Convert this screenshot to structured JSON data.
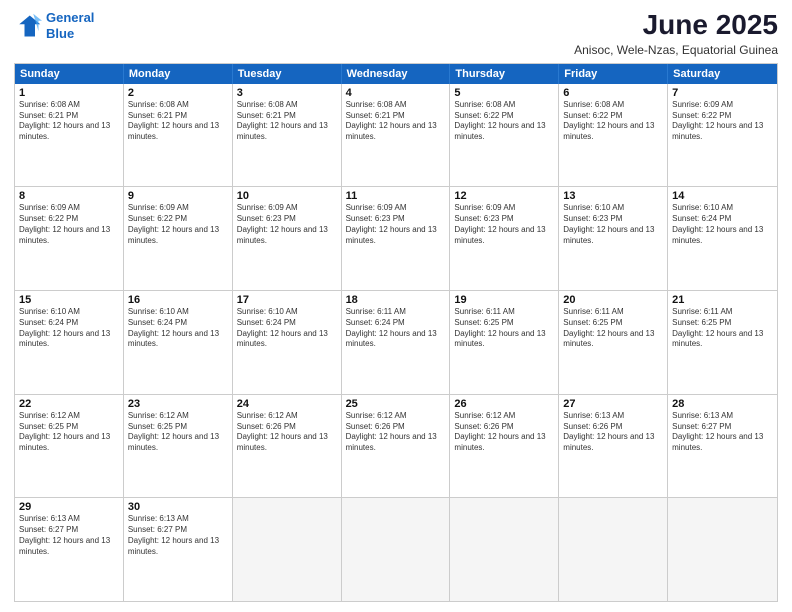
{
  "logo": {
    "line1": "General",
    "line2": "Blue"
  },
  "title": "June 2025",
  "subtitle": "Anisoc, Wele-Nzas, Equatorial Guinea",
  "header_days": [
    "Sunday",
    "Monday",
    "Tuesday",
    "Wednesday",
    "Thursday",
    "Friday",
    "Saturday"
  ],
  "weeks": [
    [
      {
        "day": "1",
        "sunrise": "Sunrise: 6:08 AM",
        "sunset": "Sunset: 6:21 PM",
        "daylight": "Daylight: 12 hours and 13 minutes."
      },
      {
        "day": "2",
        "sunrise": "Sunrise: 6:08 AM",
        "sunset": "Sunset: 6:21 PM",
        "daylight": "Daylight: 12 hours and 13 minutes."
      },
      {
        "day": "3",
        "sunrise": "Sunrise: 6:08 AM",
        "sunset": "Sunset: 6:21 PM",
        "daylight": "Daylight: 12 hours and 13 minutes."
      },
      {
        "day": "4",
        "sunrise": "Sunrise: 6:08 AM",
        "sunset": "Sunset: 6:21 PM",
        "daylight": "Daylight: 12 hours and 13 minutes."
      },
      {
        "day": "5",
        "sunrise": "Sunrise: 6:08 AM",
        "sunset": "Sunset: 6:22 PM",
        "daylight": "Daylight: 12 hours and 13 minutes."
      },
      {
        "day": "6",
        "sunrise": "Sunrise: 6:08 AM",
        "sunset": "Sunset: 6:22 PM",
        "daylight": "Daylight: 12 hours and 13 minutes."
      },
      {
        "day": "7",
        "sunrise": "Sunrise: 6:09 AM",
        "sunset": "Sunset: 6:22 PM",
        "daylight": "Daylight: 12 hours and 13 minutes."
      }
    ],
    [
      {
        "day": "8",
        "sunrise": "Sunrise: 6:09 AM",
        "sunset": "Sunset: 6:22 PM",
        "daylight": "Daylight: 12 hours and 13 minutes."
      },
      {
        "day": "9",
        "sunrise": "Sunrise: 6:09 AM",
        "sunset": "Sunset: 6:22 PM",
        "daylight": "Daylight: 12 hours and 13 minutes."
      },
      {
        "day": "10",
        "sunrise": "Sunrise: 6:09 AM",
        "sunset": "Sunset: 6:23 PM",
        "daylight": "Daylight: 12 hours and 13 minutes."
      },
      {
        "day": "11",
        "sunrise": "Sunrise: 6:09 AM",
        "sunset": "Sunset: 6:23 PM",
        "daylight": "Daylight: 12 hours and 13 minutes."
      },
      {
        "day": "12",
        "sunrise": "Sunrise: 6:09 AM",
        "sunset": "Sunset: 6:23 PM",
        "daylight": "Daylight: 12 hours and 13 minutes."
      },
      {
        "day": "13",
        "sunrise": "Sunrise: 6:10 AM",
        "sunset": "Sunset: 6:23 PM",
        "daylight": "Daylight: 12 hours and 13 minutes."
      },
      {
        "day": "14",
        "sunrise": "Sunrise: 6:10 AM",
        "sunset": "Sunset: 6:24 PM",
        "daylight": "Daylight: 12 hours and 13 minutes."
      }
    ],
    [
      {
        "day": "15",
        "sunrise": "Sunrise: 6:10 AM",
        "sunset": "Sunset: 6:24 PM",
        "daylight": "Daylight: 12 hours and 13 minutes."
      },
      {
        "day": "16",
        "sunrise": "Sunrise: 6:10 AM",
        "sunset": "Sunset: 6:24 PM",
        "daylight": "Daylight: 12 hours and 13 minutes."
      },
      {
        "day": "17",
        "sunrise": "Sunrise: 6:10 AM",
        "sunset": "Sunset: 6:24 PM",
        "daylight": "Daylight: 12 hours and 13 minutes."
      },
      {
        "day": "18",
        "sunrise": "Sunrise: 6:11 AM",
        "sunset": "Sunset: 6:24 PM",
        "daylight": "Daylight: 12 hours and 13 minutes."
      },
      {
        "day": "19",
        "sunrise": "Sunrise: 6:11 AM",
        "sunset": "Sunset: 6:25 PM",
        "daylight": "Daylight: 12 hours and 13 minutes."
      },
      {
        "day": "20",
        "sunrise": "Sunrise: 6:11 AM",
        "sunset": "Sunset: 6:25 PM",
        "daylight": "Daylight: 12 hours and 13 minutes."
      },
      {
        "day": "21",
        "sunrise": "Sunrise: 6:11 AM",
        "sunset": "Sunset: 6:25 PM",
        "daylight": "Daylight: 12 hours and 13 minutes."
      }
    ],
    [
      {
        "day": "22",
        "sunrise": "Sunrise: 6:12 AM",
        "sunset": "Sunset: 6:25 PM",
        "daylight": "Daylight: 12 hours and 13 minutes."
      },
      {
        "day": "23",
        "sunrise": "Sunrise: 6:12 AM",
        "sunset": "Sunset: 6:25 PM",
        "daylight": "Daylight: 12 hours and 13 minutes."
      },
      {
        "day": "24",
        "sunrise": "Sunrise: 6:12 AM",
        "sunset": "Sunset: 6:26 PM",
        "daylight": "Daylight: 12 hours and 13 minutes."
      },
      {
        "day": "25",
        "sunrise": "Sunrise: 6:12 AM",
        "sunset": "Sunset: 6:26 PM",
        "daylight": "Daylight: 12 hours and 13 minutes."
      },
      {
        "day": "26",
        "sunrise": "Sunrise: 6:12 AM",
        "sunset": "Sunset: 6:26 PM",
        "daylight": "Daylight: 12 hours and 13 minutes."
      },
      {
        "day": "27",
        "sunrise": "Sunrise: 6:13 AM",
        "sunset": "Sunset: 6:26 PM",
        "daylight": "Daylight: 12 hours and 13 minutes."
      },
      {
        "day": "28",
        "sunrise": "Sunrise: 6:13 AM",
        "sunset": "Sunset: 6:27 PM",
        "daylight": "Daylight: 12 hours and 13 minutes."
      }
    ],
    [
      {
        "day": "29",
        "sunrise": "Sunrise: 6:13 AM",
        "sunset": "Sunset: 6:27 PM",
        "daylight": "Daylight: 12 hours and 13 minutes."
      },
      {
        "day": "30",
        "sunrise": "Sunrise: 6:13 AM",
        "sunset": "Sunset: 6:27 PM",
        "daylight": "Daylight: 12 hours and 13 minutes."
      },
      {
        "day": "",
        "sunrise": "",
        "sunset": "",
        "daylight": ""
      },
      {
        "day": "",
        "sunrise": "",
        "sunset": "",
        "daylight": ""
      },
      {
        "day": "",
        "sunrise": "",
        "sunset": "",
        "daylight": ""
      },
      {
        "day": "",
        "sunrise": "",
        "sunset": "",
        "daylight": ""
      },
      {
        "day": "",
        "sunrise": "",
        "sunset": "",
        "daylight": ""
      }
    ]
  ]
}
